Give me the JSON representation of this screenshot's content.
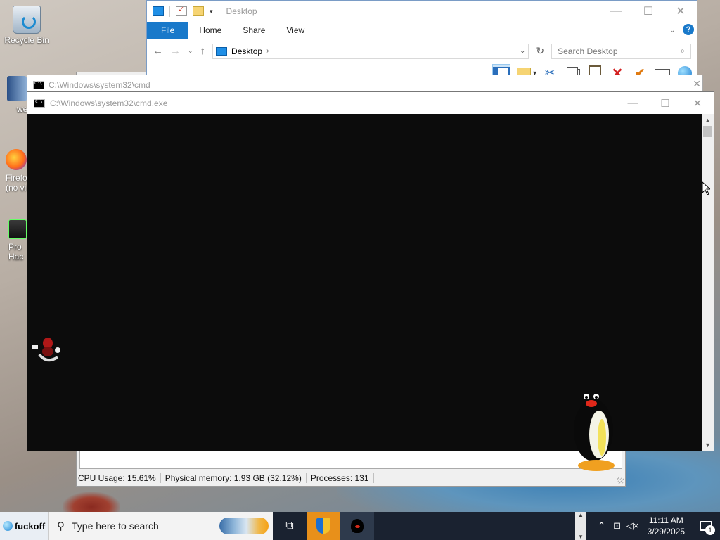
{
  "desktop": {
    "icons": [
      {
        "label": "Recycle Bin"
      },
      {
        "label": "we"
      },
      {
        "label": "Firefo (no vi"
      },
      {
        "label": "Pro Hac"
      }
    ]
  },
  "explorer": {
    "title": "Desktop",
    "tabs": [
      "File",
      "Home",
      "Share",
      "View"
    ],
    "address": "Desktop",
    "search_placeholder": "Search Desktop",
    "help_label": "?"
  },
  "cmd_back": {
    "title": "C:\\Windows\\system32\\cmd"
  },
  "cmd": {
    "title": "C:\\Windows\\system32\\cmd.exe"
  },
  "task_manager": {
    "cpu": "CPU Usage: 15.61%",
    "memory": "Physical memory: 1.93 GB (32.12%)",
    "processes": "Processes: 131"
  },
  "taskbar": {
    "start_label": "fuckoff",
    "search_placeholder": "Type here to search",
    "time": "11:11 AM",
    "date": "3/29/2025",
    "notification_count": "1"
  },
  "colors": {
    "accent": "#1979ca",
    "taskbar": "#1a2230",
    "console": "#0c0c0c"
  }
}
